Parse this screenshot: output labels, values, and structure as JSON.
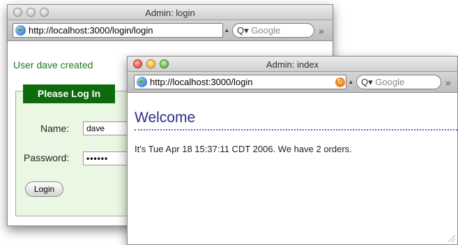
{
  "back_window": {
    "title": "Admin: login",
    "url": "http://localhost:3000/login/login",
    "search_placeholder": "Google",
    "message": "User dave created",
    "legend": "Please Log In",
    "name_label": "Name:",
    "name_value": "dave",
    "password_label": "Password:",
    "password_value": "••••••",
    "login_button": "Login",
    "more_glyph": "»"
  },
  "front_window": {
    "title": "Admin: index",
    "url": "http://localhost:3000/login",
    "search_placeholder": "Google",
    "heading": "Welcome",
    "body": "It's Tue Apr 18 15:37:11 CDT 2006. We have 2 orders.",
    "more_glyph": "»"
  },
  "colors": {
    "message_green": "#1c7a1c",
    "legend_bg": "#0d6b0d",
    "fieldset_bg": "#eaf7e2",
    "heading_color": "#2c2c8c",
    "rule_color": "#7a55b8"
  }
}
